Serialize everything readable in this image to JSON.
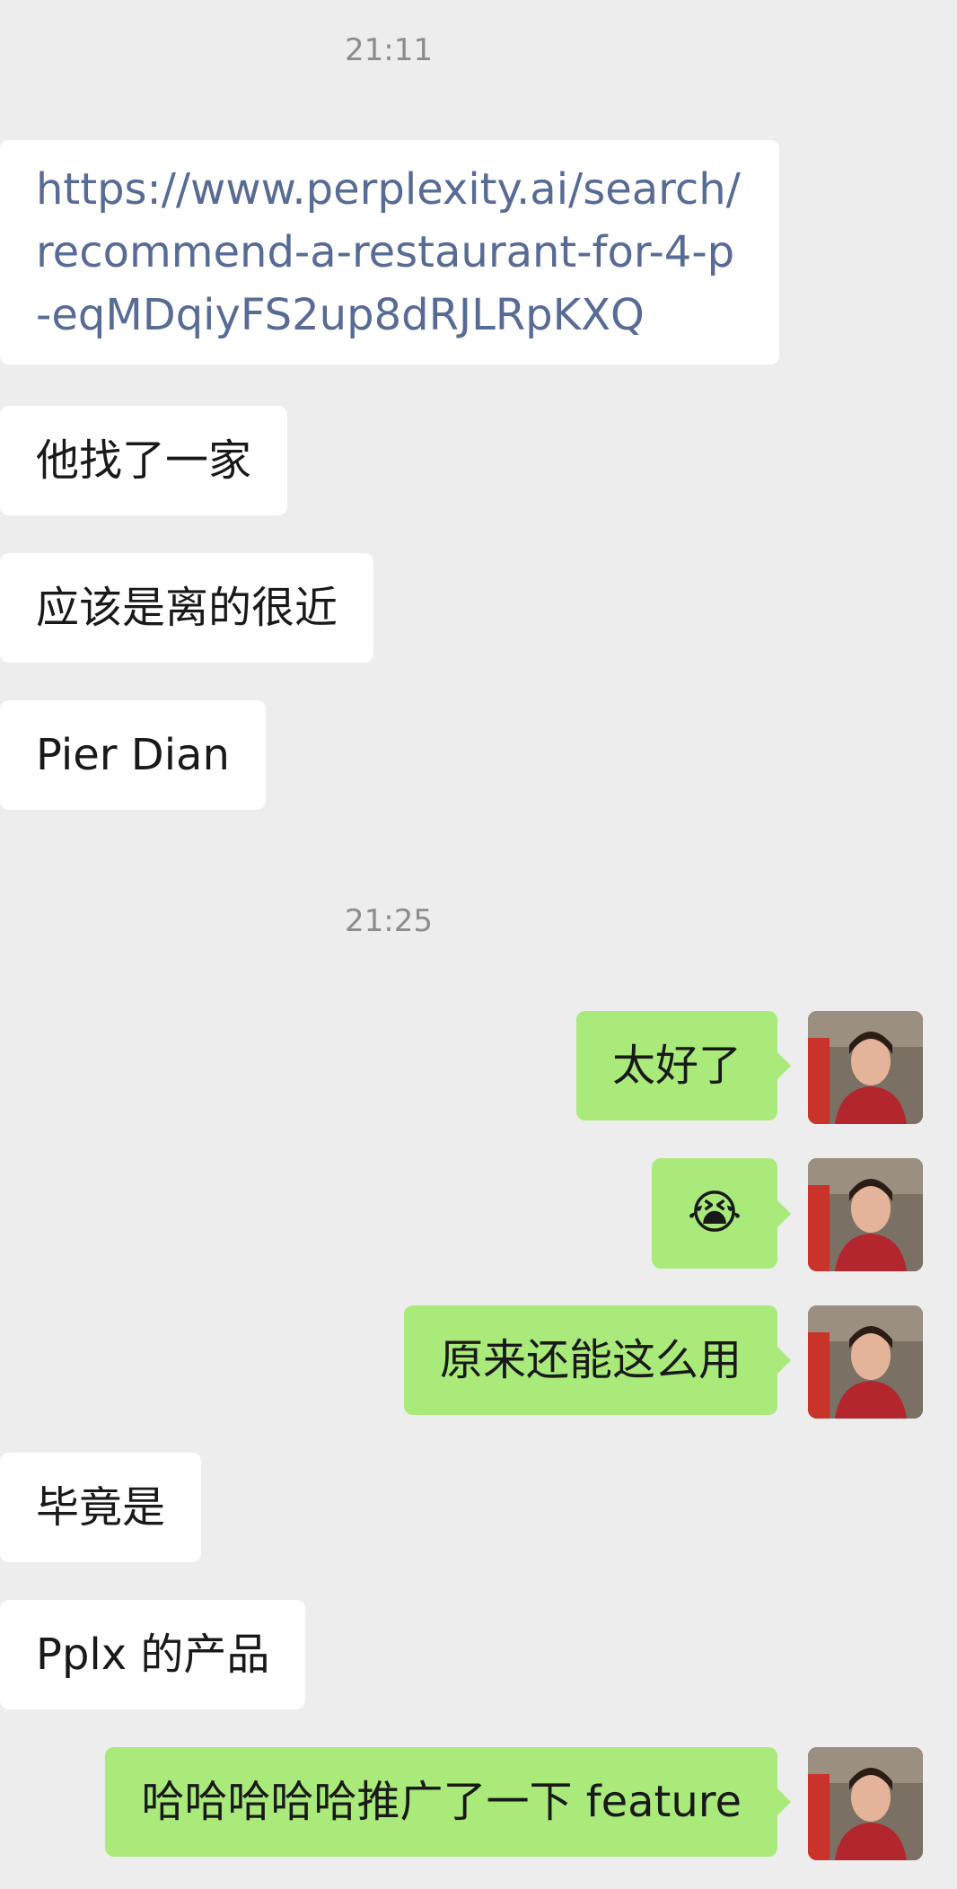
{
  "chat": {
    "timestamps": [
      "21:11",
      "21:25"
    ],
    "messages": [
      {
        "side": "left",
        "type": "link",
        "text": "https://www.perplexity.ai/search/recommend-a-restaurant-for-4-p-eqMDqiyFS2up8dRJLRpKXQ"
      },
      {
        "side": "left",
        "type": "text",
        "text": "他找了一家"
      },
      {
        "side": "left",
        "type": "text",
        "text": "应该是离的很近"
      },
      {
        "side": "left",
        "type": "text",
        "text": "Pier Dian"
      },
      {
        "side": "right",
        "type": "text",
        "text": "太好了"
      },
      {
        "side": "right",
        "type": "emoji",
        "text": "😭",
        "icon": "loudly-crying-face-icon"
      },
      {
        "side": "right",
        "type": "text",
        "text": "原来还能这么用"
      },
      {
        "side": "left",
        "type": "text",
        "text": "毕竟是"
      },
      {
        "side": "left",
        "type": "text",
        "text": "Pplx 的产品"
      },
      {
        "side": "right",
        "type": "text",
        "text": "哈哈哈哈哈推广了一下 feature"
      }
    ]
  },
  "colors": {
    "background": "#ededed",
    "incoming_bubble": "#ffffff",
    "outgoing_bubble": "#a9ea7a",
    "link": "#576b95",
    "timestamp": "#8c8c8c"
  }
}
